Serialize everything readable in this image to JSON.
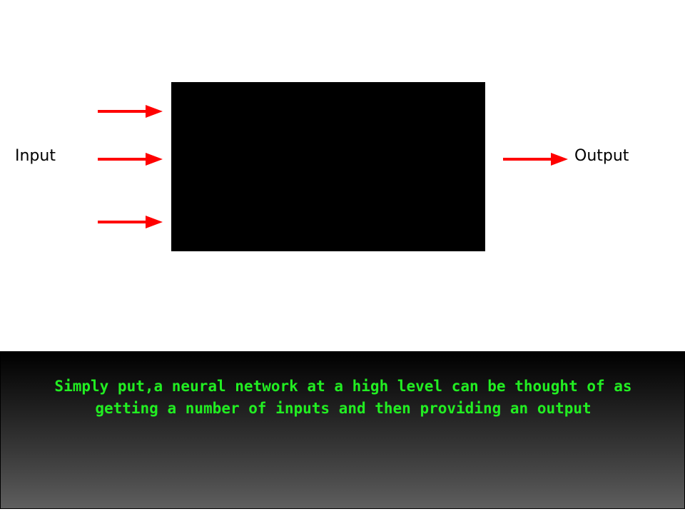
{
  "diagram": {
    "input_label": "Input",
    "output_label": "Output",
    "arrow_color": "#ff0000",
    "box_color": "#000000",
    "arrows": [
      {
        "name": "input-arrow-top",
        "icon": "arrow-right-icon"
      },
      {
        "name": "input-arrow-middle",
        "icon": "arrow-right-icon"
      },
      {
        "name": "input-arrow-bottom",
        "icon": "arrow-right-icon"
      },
      {
        "name": "output-arrow",
        "icon": "arrow-right-icon"
      }
    ]
  },
  "caption": {
    "text": "Simply put,a neural network at a high level can be thought of as getting a number of inputs and then providing an output",
    "text_color": "#22ee22"
  }
}
